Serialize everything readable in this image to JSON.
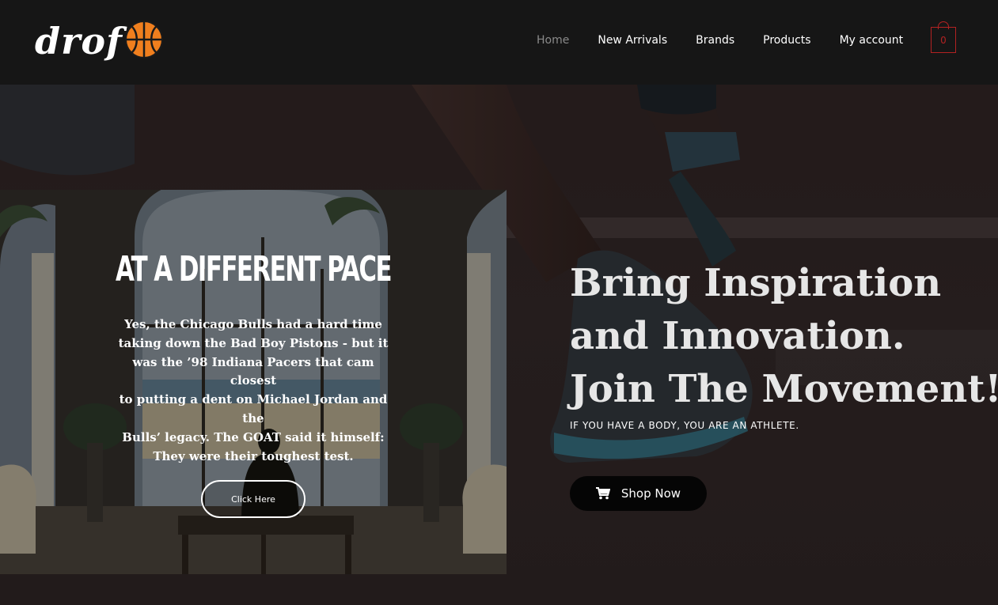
{
  "brand": {
    "name": "drof",
    "logo_icon": "basketball-icon",
    "accent": "#f07f1e"
  },
  "nav": {
    "items": [
      {
        "label": "Home",
        "active": true
      },
      {
        "label": "New Arrivals"
      },
      {
        "label": "Brands"
      },
      {
        "label": "Products"
      },
      {
        "label": "My account"
      }
    ],
    "cart_count": "0",
    "cart_color": "#b32222"
  },
  "promo": {
    "title": "AT A DIFFERENT PACE",
    "lines": [
      "Yes, the Chicago Bulls had a hard time",
      "taking down the Bad Boy Pistons - but it",
      "was the ’98 Indiana Pacers that cam closest",
      "to putting a dent on Michael Jordan and the",
      "Bulls’ legacy. The GOAT said it himself:",
      "They were their toughest test."
    ],
    "button_label": "Click Here"
  },
  "hero": {
    "headline_lines": [
      "Bring Inspiration",
      "and Innovation.",
      "Join The Movement!"
    ],
    "tagline": "IF YOU HAVE A BODY, YOU ARE AN ATHLETE.",
    "shop_button": {
      "label": "Shop Now",
      "icon": "cart-icon"
    }
  }
}
